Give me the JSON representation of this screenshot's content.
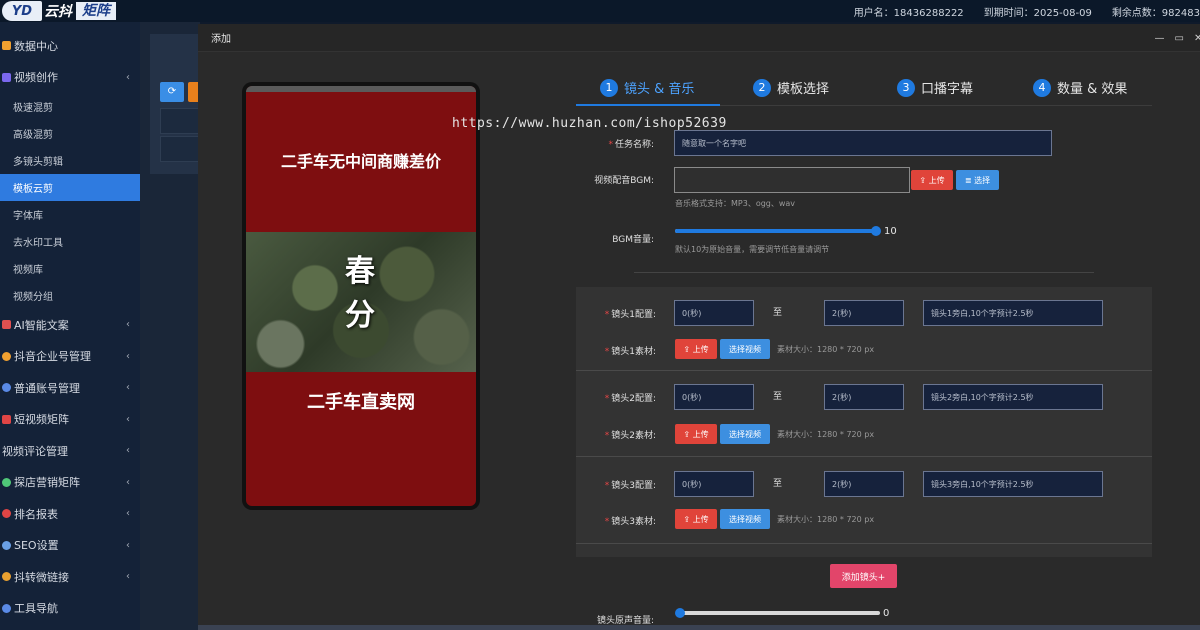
{
  "app": {
    "logo_badge": "YD",
    "logo_text1": "云抖",
    "logo_text2": "矩阵"
  },
  "header": {
    "username_label": "用户名：18436288222",
    "expire_label": "到期时间：2025-08-09",
    "points_label": "剩余点数：982483"
  },
  "sidebar": {
    "items": [
      {
        "label": "数据中心",
        "icon_color": "#f0a030"
      },
      {
        "label": "视频创作",
        "icon_color": "#7b68ee",
        "arrow": "‹"
      },
      {
        "label": "极速混剪"
      },
      {
        "label": "高级混剪"
      },
      {
        "label": "多镜头剪辑"
      },
      {
        "label": "模板云剪"
      },
      {
        "label": "字体库"
      },
      {
        "label": "去水印工具"
      },
      {
        "label": "视频库"
      },
      {
        "label": "视频分组"
      },
      {
        "label": "AI智能文案",
        "icon_color": "#e05050",
        "arrow": "‹"
      },
      {
        "label": "抖音企业号管理",
        "icon_color": "#f0a030",
        "arrow": "‹"
      },
      {
        "label": "普通账号管理",
        "icon_color": "#5a8ae6",
        "arrow": "‹"
      },
      {
        "label": "短视频矩阵",
        "icon_color": "#e04545",
        "arrow": "‹"
      },
      {
        "label": "视频评论管理",
        "arrow": "‹"
      },
      {
        "label": "探店营销矩阵",
        "icon_color": "#50c878",
        "arrow": "‹"
      },
      {
        "label": "排名报表",
        "icon_color": "#e04545",
        "arrow": "‹"
      },
      {
        "label": "SEO设置",
        "icon_color": "#6aa0e6",
        "arrow": "‹"
      },
      {
        "label": "抖转微链接",
        "icon_color": "#e8a030",
        "arrow": "‹"
      },
      {
        "label": "工具导航",
        "icon_color": "#5a8ae6"
      }
    ]
  },
  "modal": {
    "title": "添加",
    "minimize": "—",
    "maximize": "▭",
    "close": "✕"
  },
  "preview": {
    "title_top": "二手车无中间商赚差价",
    "image_text_line1": "春",
    "image_text_line2": "分",
    "title_bottom": "二手车直卖网"
  },
  "steps": [
    {
      "num": "1",
      "label": "镜头 & 音乐"
    },
    {
      "num": "2",
      "label": "模板选择"
    },
    {
      "num": "3",
      "label": "口播字幕"
    },
    {
      "num": "4",
      "label": "数量 & 效果"
    }
  ],
  "watermark": "https://www.huzhan.com/ishop52639",
  "form": {
    "task_name_label": "任务名称:",
    "task_name_placeholder": "随意取一个名字吧",
    "bgm_label": "视频配音BGM:",
    "upload_label": "上传",
    "select_label": "选择",
    "bgm_hint": "音乐格式支持：MP3、ogg、wav",
    "bgm_volume_label": "BGM音量:",
    "bgm_volume_value": "10",
    "bgm_volume_fraction": 1.0,
    "bgm_volume_hint": "默认10为原始音量，需要调节低音量请调节",
    "shots": [
      {
        "config_label": "镜头1配置:",
        "start": "0(秒)",
        "to": "至",
        "end": "2(秒)",
        "narration": "镜头1旁白,10个字预计2.5秒",
        "material_label": "镜头1素材:",
        "upload": "上传",
        "select_video": "选择视频",
        "size_hint": "素材大小：1280 * 720 px"
      },
      {
        "config_label": "镜头2配置:",
        "start": "0(秒)",
        "to": "至",
        "end": "2(秒)",
        "narration": "镜头2旁白,10个字预计2.5秒",
        "material_label": "镜头2素材:",
        "upload": "上传",
        "select_video": "选择视频",
        "size_hint": "素材大小：1280 * 720 px"
      },
      {
        "config_label": "镜头3配置:",
        "start": "0(秒)",
        "to": "至",
        "end": "2(秒)",
        "narration": "镜头3旁白,10个字预计2.5秒",
        "material_label": "镜头3素材:",
        "upload": "上传",
        "select_video": "选择视频",
        "size_hint": "素材大小：1280 * 720 px"
      }
    ],
    "add_shot_label": "添加镜头+",
    "orig_volume_label": "镜头原声音量:",
    "orig_volume_value": "0",
    "orig_volume_fraction": 0.0
  }
}
